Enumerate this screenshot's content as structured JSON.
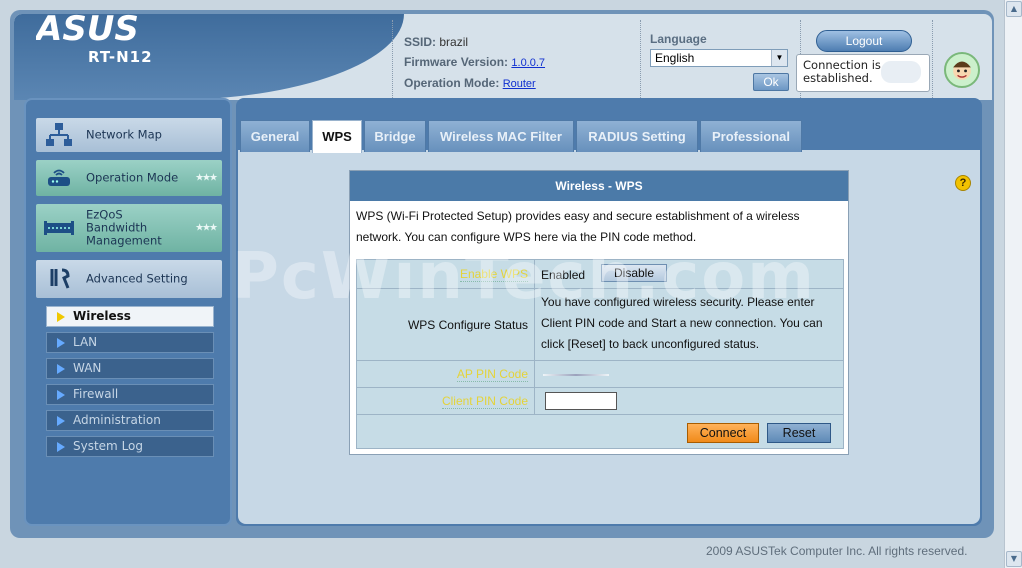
{
  "header": {
    "brand": "ASUS",
    "model": "RT-N12",
    "ssid_label": "SSID:",
    "ssid_value": "brazil",
    "firmware_label": "Firmware Version:",
    "firmware_value": "1.0.0.7",
    "mode_label": "Operation Mode:",
    "mode_value": "Router",
    "language_label": "Language",
    "language_selected": "English",
    "ok_label": "Ok",
    "logout_label": "Logout",
    "connection_status": "Connection is established."
  },
  "sidebar": {
    "items": [
      {
        "label": "Network Map",
        "icon": "network-map-icon"
      },
      {
        "label": "Operation Mode",
        "icon": "router-icon"
      },
      {
        "label": "EzQoS Bandwidth Management",
        "icon": "bandwidth-icon"
      },
      {
        "label": "Advanced Setting",
        "icon": "wrench-icon"
      }
    ],
    "subitems": [
      {
        "label": "Wireless",
        "active": true
      },
      {
        "label": "LAN"
      },
      {
        "label": "WAN"
      },
      {
        "label": "Firewall"
      },
      {
        "label": "Administration"
      },
      {
        "label": "System Log"
      }
    ]
  },
  "tabs": [
    {
      "label": "General"
    },
    {
      "label": "WPS",
      "active": true
    },
    {
      "label": "Bridge"
    },
    {
      "label": "Wireless MAC Filter"
    },
    {
      "label": "RADIUS Setting"
    },
    {
      "label": "Professional"
    }
  ],
  "wps": {
    "title": "Wireless - WPS",
    "description": "WPS (Wi-Fi Protected Setup) provides easy and secure establishment of a wireless network. You can configure WPS here via the PIN code method.",
    "enable_label": "Enable WPS",
    "enable_value": "Enabled",
    "disable_button": "Disable",
    "status_label": "WPS Configure Status",
    "status_value": "You have configured wireless security. Please enter Client PIN code and Start a new connection. You can click [Reset] to back unconfigured status.",
    "ap_pin_label": "AP PIN Code",
    "client_pin_label": "Client PIN Code",
    "client_pin_value": "",
    "connect_button": "Connect",
    "reset_button": "Reset"
  },
  "watermark": "PcWinTech.com",
  "footer": {
    "copyright": "2009 ASUSTek Computer Inc. All rights reserved."
  },
  "colors": {
    "accent": "#4e7bac",
    "connect": "#f08a1a",
    "link_label": "#e4d33a"
  }
}
